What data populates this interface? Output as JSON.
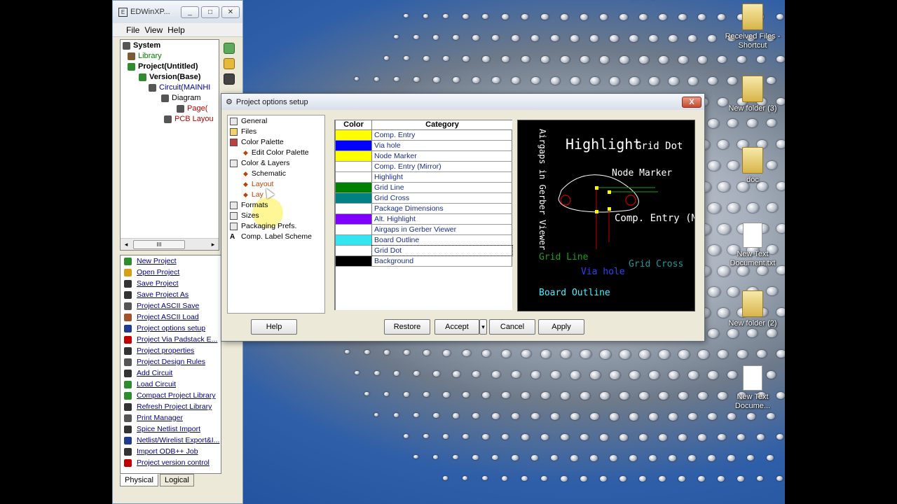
{
  "main_window": {
    "title": "EDWinXP...",
    "menu": [
      "File",
      "View",
      "Help"
    ],
    "tree": [
      {
        "label": "System",
        "color": "#000000",
        "bold": true
      },
      {
        "label": "Library",
        "color": "#008000",
        "bold": false
      },
      {
        "label": "Project(Untitled)",
        "color": "#000000",
        "bold": true
      },
      {
        "label": "Version(Base)",
        "color": "#000000",
        "bold": true
      },
      {
        "label": "Circuit(MAINHI",
        "color": "#0000a0",
        "bold": false
      },
      {
        "label": "Diagram",
        "color": "#000000",
        "bold": false
      },
      {
        "label": "Page(",
        "color": "#c00000",
        "bold": false
      },
      {
        "label": "PCB Layou",
        "color": "#c00000",
        "bold": false
      }
    ],
    "scroll_grip": "III",
    "commands": [
      {
        "label": "New Project",
        "icon": "new-project-icon",
        "color": "#2e8b2e"
      },
      {
        "label": "Open Project",
        "icon": "open-folder-icon",
        "color": "#d4a017"
      },
      {
        "label": "Save Project",
        "icon": "save-icon",
        "color": "#333333"
      },
      {
        "label": "Save Project As",
        "icon": "save-as-icon",
        "color": "#333333"
      },
      {
        "label": "Project ASCII Save",
        "icon": "ascii-save-icon",
        "color": "#555555"
      },
      {
        "label": "Project ASCII Load",
        "icon": "ascii-load-icon",
        "color": "#a0522d"
      },
      {
        "label": "Project options setup",
        "icon": "options-gear-icon",
        "color": "#1e3c8c"
      },
      {
        "label": "Project Via Padstack E...",
        "icon": "via-icon",
        "color": "#c00000"
      },
      {
        "label": "Project properties",
        "icon": "properties-icon",
        "color": "#333333"
      },
      {
        "label": "Project Design Rules",
        "icon": "design-rules-icon",
        "color": "#555555"
      },
      {
        "label": "Add Circuit",
        "icon": "add-circuit-icon",
        "color": "#333333"
      },
      {
        "label": "Load Circuit",
        "icon": "load-circuit-icon",
        "color": "#2e8b2e"
      },
      {
        "label": "Compact Project Library",
        "icon": "compact-library-icon",
        "color": "#2e8b2e"
      },
      {
        "label": "Refresh Project Library",
        "icon": "refresh-library-icon",
        "color": "#333333"
      },
      {
        "label": "Print Manager",
        "icon": "printer-icon",
        "color": "#555555"
      },
      {
        "label": "Spice Netlist Import",
        "icon": "spice-icon",
        "color": "#333333"
      },
      {
        "label": "Netlist/Wirelist Export&I...",
        "icon": "netlist-icon",
        "color": "#1e3c8c"
      },
      {
        "label": "Import ODB++ Job",
        "icon": "odb-import-icon",
        "color": "#333333"
      },
      {
        "label": "Project version control",
        "icon": "version-control-icon",
        "color": "#c00000"
      }
    ],
    "bottom_tabs": [
      "Physical",
      "Logical"
    ]
  },
  "dialog": {
    "title": "Project options setup",
    "close_label": "X",
    "options_tree": [
      {
        "label": "General",
        "level": 0,
        "icon": "gear-icon"
      },
      {
        "label": "Files",
        "level": 0,
        "icon": "folder-icon"
      },
      {
        "label": "Color Palette",
        "level": 0,
        "icon": "palette-icon"
      },
      {
        "label": "Edit Color Palette",
        "level": 1,
        "icon": "diamond-icon"
      },
      {
        "label": "Color & Layers",
        "level": 0,
        "icon": "layers-icon"
      },
      {
        "label": "Schematic",
        "level": 1,
        "icon": "diamond-icon"
      },
      {
        "label": "Layout",
        "level": 1,
        "icon": "diamond-icon"
      },
      {
        "label": "Lay",
        "level": 1,
        "icon": "diamond-icon"
      },
      {
        "label": "Formats",
        "level": 0,
        "icon": "formats-icon"
      },
      {
        "label": "Sizes",
        "level": 0,
        "icon": "sizes-icon"
      },
      {
        "label": "Packaging Prefs.",
        "level": 0,
        "icon": "packaging-icon"
      },
      {
        "label": "Comp. Label Scheme",
        "level": 0,
        "icon": "label-a-icon"
      }
    ],
    "table_headers": {
      "color": "Color",
      "category": "Category"
    },
    "color_rows": [
      {
        "color": "#ffff00",
        "category": "Comp. Entry"
      },
      {
        "color": "#0000ff",
        "category": "Via hole"
      },
      {
        "color": "#ffff00",
        "category": "Node Marker"
      },
      {
        "color": "#ffffff",
        "category": "Comp. Entry (Mirror)"
      },
      {
        "color": "#ffffff",
        "category": "Highlight"
      },
      {
        "color": "#008000",
        "category": "Grid Line"
      },
      {
        "color": "#008080",
        "category": "Grid Cross"
      },
      {
        "color": "#ffffff",
        "category": "Package Dimensions"
      },
      {
        "color": "#8000ff",
        "category": "Alt. Highlight"
      },
      {
        "color": "#ffffff",
        "category": "Airgaps in Gerber Viewer"
      },
      {
        "color": "#33e5f0",
        "category": "Board Outline"
      },
      {
        "color": "#ffffff",
        "category": "Grid Dot"
      },
      {
        "color": "#000000",
        "category": "Background"
      }
    ],
    "preview": {
      "highlight": "Highlight",
      "grid_dot": "Grid Dot",
      "airgaps": "Airgaps in Gerber Viewer",
      "node_marker": "Node Marker",
      "comp_entry_mirror": "Comp. Entry (Mirror)",
      "grid_line": "Grid Line",
      "via_hole": "Via hole",
      "grid_cross": "Grid Cross",
      "board_outline": "Board Outline"
    },
    "buttons": {
      "help": "Help",
      "restore": "Restore",
      "accept": "Accept",
      "accept_arrow": "▾",
      "cancel": "Cancel",
      "apply": "Apply"
    }
  },
  "desktop_icons": [
    {
      "label": "Received Files - Shortcut",
      "type": "folder"
    },
    {
      "label": "New folder (3)",
      "type": "folder"
    },
    {
      "label": "doc",
      "type": "folder"
    },
    {
      "label": "New Text Document.txt",
      "type": "text"
    },
    {
      "label": "New folder (2)",
      "type": "folder"
    },
    {
      "label": "New Text Docume...",
      "type": "text"
    }
  ]
}
